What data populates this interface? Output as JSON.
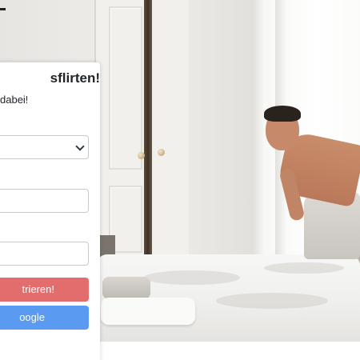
{
  "signup_card": {
    "title": "sflirten!",
    "subtitle": "dabei!",
    "gender_select": {
      "selected": ""
    },
    "email_input": {
      "value": "",
      "placeholder": ""
    },
    "password_input": {
      "value": "",
      "placeholder": ""
    },
    "register_button_label": "trieren!",
    "google_button_label": "oogle"
  },
  "colors": {
    "register_button": "#e26d6d",
    "google_button": "#5a9af0",
    "card_background": "#ffffff"
  },
  "icons": {
    "select_caret": "chevron-down-icon"
  }
}
